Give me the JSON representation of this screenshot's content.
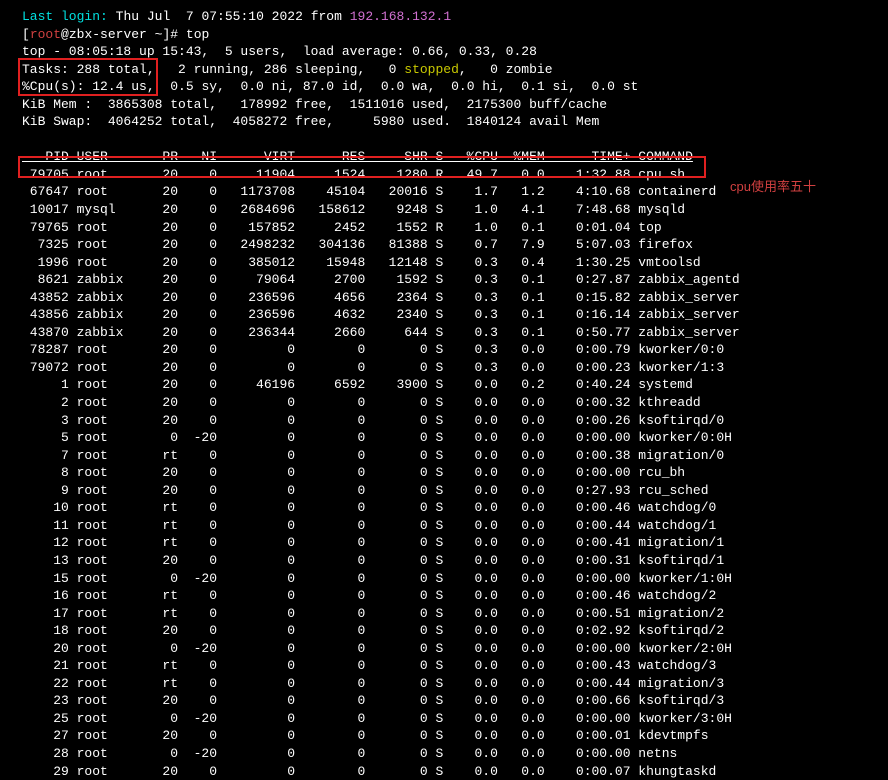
{
  "login": {
    "prefix": "Last login:",
    "date": "Thu Jul  7 07:55:10 2022",
    "from_word": "from",
    "ip": "192.168.132.1"
  },
  "prompt": {
    "user": "root",
    "host": "zbx-server",
    "path": "~",
    "cmd": "top"
  },
  "top": {
    "summary1": "top - 08:05:18 up 15:43,  5 users,  load average: 0.66, 0.33, 0.28",
    "tasks_label": "Tasks:",
    "tasks_total": "288 total,",
    "tasks_rest": "   2 running, 286 sleeping,   0 ",
    "stopped_word": "stopped",
    "tasks_tail": ",   0 zombie",
    "cpu_label": "%Cpu(s):",
    "cpu_us": " 12.4 us,",
    "cpu_rest": "  0.5 sy,  0.0 ni, 87.0 id,  0.0 wa,  0.0 hi,  0.1 si,  0.0 st",
    "mem_line": "KiB Mem :  3865308 total,   178992 free,  1511016 used,  2175300 buff/cache",
    "swap_line": "KiB Swap:  4064252 total,  4058272 free,     5980 used.  1840124 avail Mem"
  },
  "annotation": "cpu使用率五十",
  "columns": [
    "PID",
    "USER",
    "PR",
    "NI",
    "VIRT",
    "RES",
    "SHR",
    "S",
    "%CPU",
    "%MEM",
    "TIME+",
    "COMMAND"
  ],
  "processes": [
    {
      "pid": "79705",
      "user": "root",
      "pr": "20",
      "ni": "0",
      "virt": "11904",
      "res": "1524",
      "shr": "1280",
      "s": "R",
      "cpu": "49.7",
      "mem": "0.0",
      "time": "1:32.88",
      "cmd": "cpu.sh"
    },
    {
      "pid": "67647",
      "user": "root",
      "pr": "20",
      "ni": "0",
      "virt": "1173708",
      "res": "45104",
      "shr": "20016",
      "s": "S",
      "cpu": "1.7",
      "mem": "1.2",
      "time": "4:10.68",
      "cmd": "containerd"
    },
    {
      "pid": "10017",
      "user": "mysql",
      "pr": "20",
      "ni": "0",
      "virt": "2684696",
      "res": "158612",
      "shr": "9248",
      "s": "S",
      "cpu": "1.0",
      "mem": "4.1",
      "time": "7:48.68",
      "cmd": "mysqld"
    },
    {
      "pid": "79765",
      "user": "root",
      "pr": "20",
      "ni": "0",
      "virt": "157852",
      "res": "2452",
      "shr": "1552",
      "s": "R",
      "cpu": "1.0",
      "mem": "0.1",
      "time": "0:01.04",
      "cmd": "top"
    },
    {
      "pid": "7325",
      "user": "root",
      "pr": "20",
      "ni": "0",
      "virt": "2498232",
      "res": "304136",
      "shr": "81388",
      "s": "S",
      "cpu": "0.7",
      "mem": "7.9",
      "time": "5:07.03",
      "cmd": "firefox"
    },
    {
      "pid": "1996",
      "user": "root",
      "pr": "20",
      "ni": "0",
      "virt": "385012",
      "res": "15948",
      "shr": "12148",
      "s": "S",
      "cpu": "0.3",
      "mem": "0.4",
      "time": "1:30.25",
      "cmd": "vmtoolsd"
    },
    {
      "pid": "8621",
      "user": "zabbix",
      "pr": "20",
      "ni": "0",
      "virt": "79064",
      "res": "2700",
      "shr": "1592",
      "s": "S",
      "cpu": "0.3",
      "mem": "0.1",
      "time": "0:27.87",
      "cmd": "zabbix_agentd"
    },
    {
      "pid": "43852",
      "user": "zabbix",
      "pr": "20",
      "ni": "0",
      "virt": "236596",
      "res": "4656",
      "shr": "2364",
      "s": "S",
      "cpu": "0.3",
      "mem": "0.1",
      "time": "0:15.82",
      "cmd": "zabbix_server"
    },
    {
      "pid": "43856",
      "user": "zabbix",
      "pr": "20",
      "ni": "0",
      "virt": "236596",
      "res": "4632",
      "shr": "2340",
      "s": "S",
      "cpu": "0.3",
      "mem": "0.1",
      "time": "0:16.14",
      "cmd": "zabbix_server"
    },
    {
      "pid": "43870",
      "user": "zabbix",
      "pr": "20",
      "ni": "0",
      "virt": "236344",
      "res": "2660",
      "shr": "644",
      "s": "S",
      "cpu": "0.3",
      "mem": "0.1",
      "time": "0:50.77",
      "cmd": "zabbix_server"
    },
    {
      "pid": "78287",
      "user": "root",
      "pr": "20",
      "ni": "0",
      "virt": "0",
      "res": "0",
      "shr": "0",
      "s": "S",
      "cpu": "0.3",
      "mem": "0.0",
      "time": "0:00.79",
      "cmd": "kworker/0:0"
    },
    {
      "pid": "79072",
      "user": "root",
      "pr": "20",
      "ni": "0",
      "virt": "0",
      "res": "0",
      "shr": "0",
      "s": "S",
      "cpu": "0.3",
      "mem": "0.0",
      "time": "0:00.23",
      "cmd": "kworker/1:3"
    },
    {
      "pid": "1",
      "user": "root",
      "pr": "20",
      "ni": "0",
      "virt": "46196",
      "res": "6592",
      "shr": "3900",
      "s": "S",
      "cpu": "0.0",
      "mem": "0.2",
      "time": "0:40.24",
      "cmd": "systemd"
    },
    {
      "pid": "2",
      "user": "root",
      "pr": "20",
      "ni": "0",
      "virt": "0",
      "res": "0",
      "shr": "0",
      "s": "S",
      "cpu": "0.0",
      "mem": "0.0",
      "time": "0:00.32",
      "cmd": "kthreadd"
    },
    {
      "pid": "3",
      "user": "root",
      "pr": "20",
      "ni": "0",
      "virt": "0",
      "res": "0",
      "shr": "0",
      "s": "S",
      "cpu": "0.0",
      "mem": "0.0",
      "time": "0:00.26",
      "cmd": "ksoftirqd/0"
    },
    {
      "pid": "5",
      "user": "root",
      "pr": "0",
      "ni": "-20",
      "virt": "0",
      "res": "0",
      "shr": "0",
      "s": "S",
      "cpu": "0.0",
      "mem": "0.0",
      "time": "0:00.00",
      "cmd": "kworker/0:0H"
    },
    {
      "pid": "7",
      "user": "root",
      "pr": "rt",
      "ni": "0",
      "virt": "0",
      "res": "0",
      "shr": "0",
      "s": "S",
      "cpu": "0.0",
      "mem": "0.0",
      "time": "0:00.38",
      "cmd": "migration/0"
    },
    {
      "pid": "8",
      "user": "root",
      "pr": "20",
      "ni": "0",
      "virt": "0",
      "res": "0",
      "shr": "0",
      "s": "S",
      "cpu": "0.0",
      "mem": "0.0",
      "time": "0:00.00",
      "cmd": "rcu_bh"
    },
    {
      "pid": "9",
      "user": "root",
      "pr": "20",
      "ni": "0",
      "virt": "0",
      "res": "0",
      "shr": "0",
      "s": "S",
      "cpu": "0.0",
      "mem": "0.0",
      "time": "0:27.93",
      "cmd": "rcu_sched"
    },
    {
      "pid": "10",
      "user": "root",
      "pr": "rt",
      "ni": "0",
      "virt": "0",
      "res": "0",
      "shr": "0",
      "s": "S",
      "cpu": "0.0",
      "mem": "0.0",
      "time": "0:00.46",
      "cmd": "watchdog/0"
    },
    {
      "pid": "11",
      "user": "root",
      "pr": "rt",
      "ni": "0",
      "virt": "0",
      "res": "0",
      "shr": "0",
      "s": "S",
      "cpu": "0.0",
      "mem": "0.0",
      "time": "0:00.44",
      "cmd": "watchdog/1"
    },
    {
      "pid": "12",
      "user": "root",
      "pr": "rt",
      "ni": "0",
      "virt": "0",
      "res": "0",
      "shr": "0",
      "s": "S",
      "cpu": "0.0",
      "mem": "0.0",
      "time": "0:00.41",
      "cmd": "migration/1"
    },
    {
      "pid": "13",
      "user": "root",
      "pr": "20",
      "ni": "0",
      "virt": "0",
      "res": "0",
      "shr": "0",
      "s": "S",
      "cpu": "0.0",
      "mem": "0.0",
      "time": "0:00.31",
      "cmd": "ksoftirqd/1"
    },
    {
      "pid": "15",
      "user": "root",
      "pr": "0",
      "ni": "-20",
      "virt": "0",
      "res": "0",
      "shr": "0",
      "s": "S",
      "cpu": "0.0",
      "mem": "0.0",
      "time": "0:00.00",
      "cmd": "kworker/1:0H"
    },
    {
      "pid": "16",
      "user": "root",
      "pr": "rt",
      "ni": "0",
      "virt": "0",
      "res": "0",
      "shr": "0",
      "s": "S",
      "cpu": "0.0",
      "mem": "0.0",
      "time": "0:00.46",
      "cmd": "watchdog/2"
    },
    {
      "pid": "17",
      "user": "root",
      "pr": "rt",
      "ni": "0",
      "virt": "0",
      "res": "0",
      "shr": "0",
      "s": "S",
      "cpu": "0.0",
      "mem": "0.0",
      "time": "0:00.51",
      "cmd": "migration/2"
    },
    {
      "pid": "18",
      "user": "root",
      "pr": "20",
      "ni": "0",
      "virt": "0",
      "res": "0",
      "shr": "0",
      "s": "S",
      "cpu": "0.0",
      "mem": "0.0",
      "time": "0:02.92",
      "cmd": "ksoftirqd/2"
    },
    {
      "pid": "20",
      "user": "root",
      "pr": "0",
      "ni": "-20",
      "virt": "0",
      "res": "0",
      "shr": "0",
      "s": "S",
      "cpu": "0.0",
      "mem": "0.0",
      "time": "0:00.00",
      "cmd": "kworker/2:0H"
    },
    {
      "pid": "21",
      "user": "root",
      "pr": "rt",
      "ni": "0",
      "virt": "0",
      "res": "0",
      "shr": "0",
      "s": "S",
      "cpu": "0.0",
      "mem": "0.0",
      "time": "0:00.43",
      "cmd": "watchdog/3"
    },
    {
      "pid": "22",
      "user": "root",
      "pr": "rt",
      "ni": "0",
      "virt": "0",
      "res": "0",
      "shr": "0",
      "s": "S",
      "cpu": "0.0",
      "mem": "0.0",
      "time": "0:00.44",
      "cmd": "migration/3"
    },
    {
      "pid": "23",
      "user": "root",
      "pr": "20",
      "ni": "0",
      "virt": "0",
      "res": "0",
      "shr": "0",
      "s": "S",
      "cpu": "0.0",
      "mem": "0.0",
      "time": "0:00.66",
      "cmd": "ksoftirqd/3"
    },
    {
      "pid": "25",
      "user": "root",
      "pr": "0",
      "ni": "-20",
      "virt": "0",
      "res": "0",
      "shr": "0",
      "s": "S",
      "cpu": "0.0",
      "mem": "0.0",
      "time": "0:00.00",
      "cmd": "kworker/3:0H"
    },
    {
      "pid": "27",
      "user": "root",
      "pr": "20",
      "ni": "0",
      "virt": "0",
      "res": "0",
      "shr": "0",
      "s": "S",
      "cpu": "0.0",
      "mem": "0.0",
      "time": "0:00.01",
      "cmd": "kdevtmpfs"
    },
    {
      "pid": "28",
      "user": "root",
      "pr": "0",
      "ni": "-20",
      "virt": "0",
      "res": "0",
      "shr": "0",
      "s": "S",
      "cpu": "0.0",
      "mem": "0.0",
      "time": "0:00.00",
      "cmd": "netns"
    },
    {
      "pid": "29",
      "user": "root",
      "pr": "20",
      "ni": "0",
      "virt": "0",
      "res": "0",
      "shr": "0",
      "s": "S",
      "cpu": "0.0",
      "mem": "0.0",
      "time": "0:00.07",
      "cmd": "khungtaskd"
    }
  ]
}
